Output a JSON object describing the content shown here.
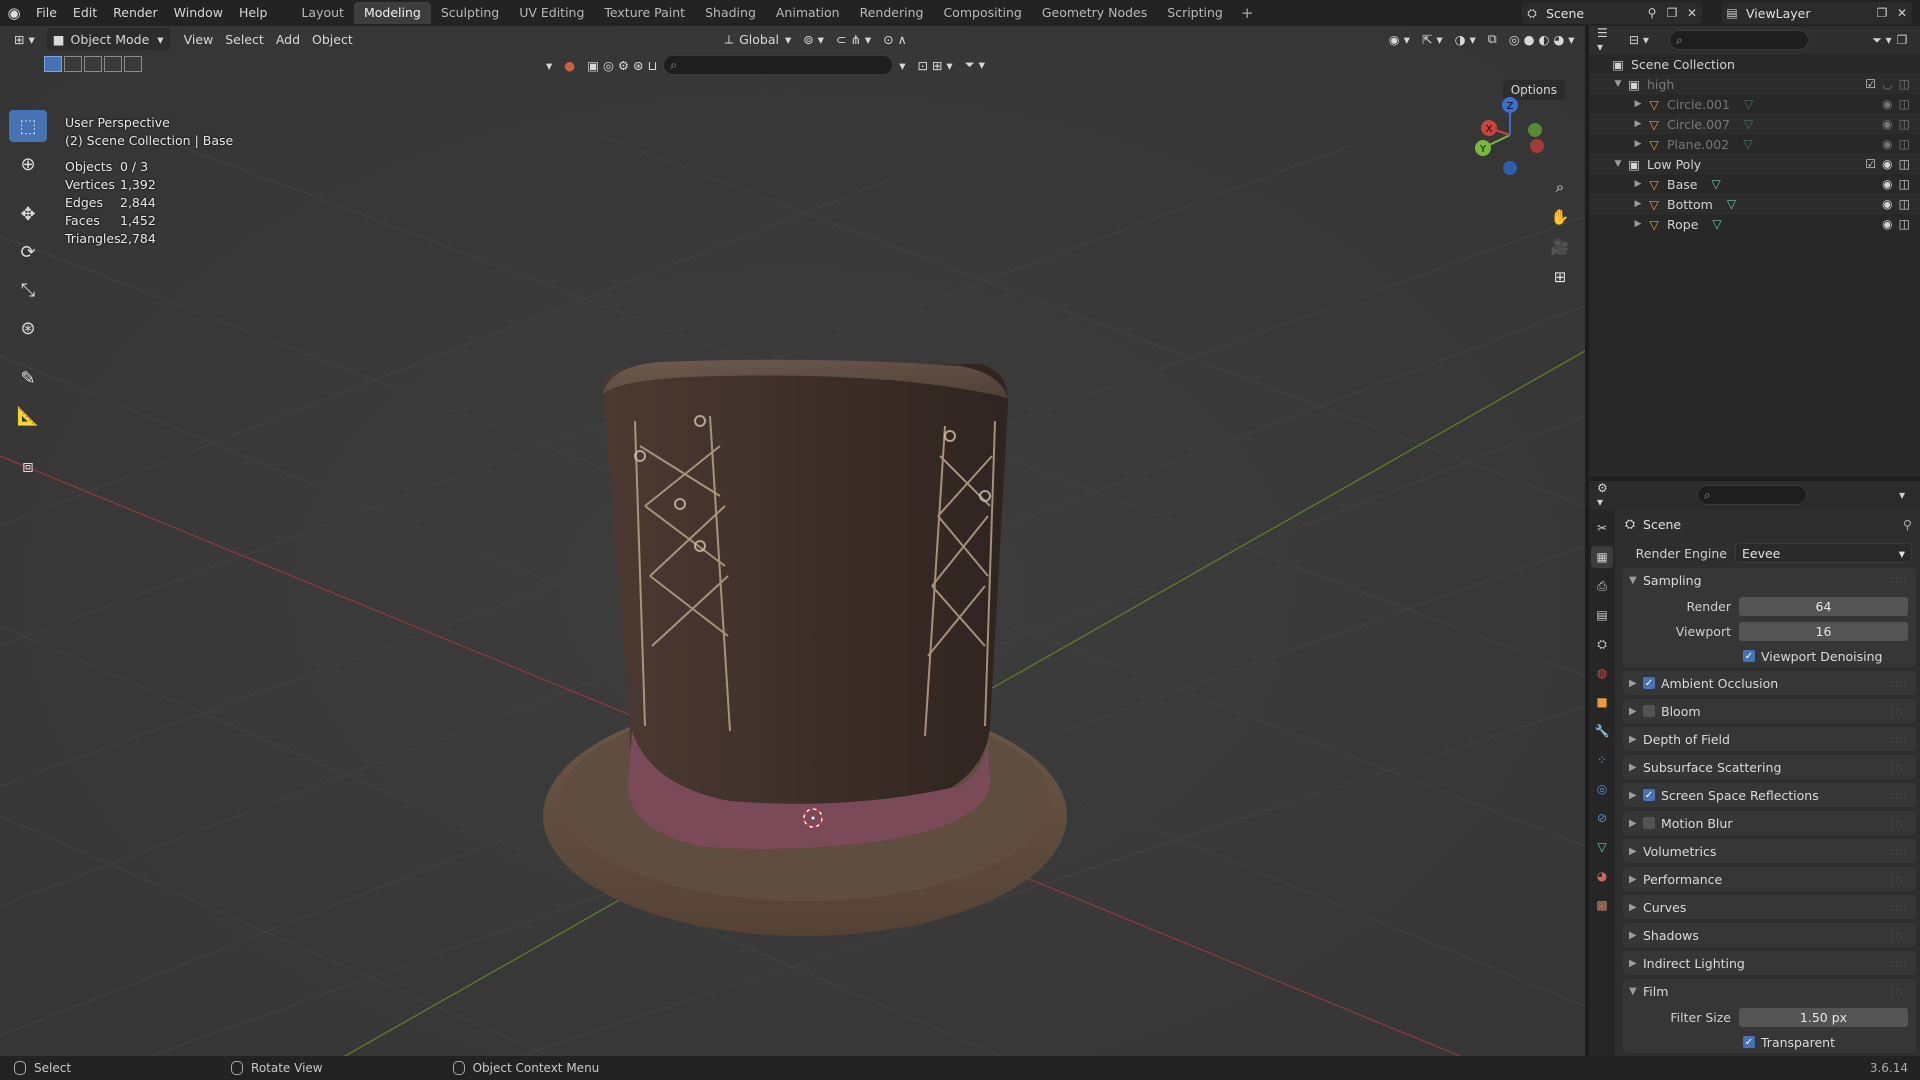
{
  "topbar": {
    "menus": [
      "File",
      "Edit",
      "Render",
      "Window",
      "Help"
    ],
    "workspaces": [
      "Layout",
      "Modeling",
      "Sculpting",
      "UV Editing",
      "Texture Paint",
      "Shading",
      "Animation",
      "Rendering",
      "Compositing",
      "Geometry Nodes",
      "Scripting"
    ],
    "active_workspace": "Modeling",
    "scene_name": "Scene",
    "view_layer": "ViewLayer"
  },
  "viewport": {
    "mode": "Object Mode",
    "menus": [
      "View",
      "Select",
      "Add",
      "Object"
    ],
    "transform_orientation": "Global",
    "options_label": "Options",
    "perspective_label": "User Perspective",
    "collection_label": "(2) Scene Collection | Base",
    "stats": [
      {
        "label": "Objects",
        "value": "0 / 3"
      },
      {
        "label": "Vertices",
        "value": "1,392"
      },
      {
        "label": "Edges",
        "value": "2,844"
      },
      {
        "label": "Faces",
        "value": "1,452"
      },
      {
        "label": "Triangles",
        "value": "2,784"
      }
    ],
    "gizmo_axes": {
      "x": "X",
      "y": "Y",
      "z": "Z"
    }
  },
  "outliner": {
    "root": "Scene Collection",
    "collections": [
      {
        "name": "high",
        "objects": [
          "Circle.001",
          "Circle.007",
          "Plane.002"
        ]
      },
      {
        "name": "Low Poly",
        "objects": [
          "Base",
          "Bottom",
          "Rope"
        ]
      }
    ]
  },
  "properties": {
    "context": "Scene",
    "render_engine_label": "Render Engine",
    "render_engine": "Eevee",
    "sampling": {
      "title": "Sampling",
      "render_label": "Render",
      "render": "64",
      "viewport_label": "Viewport",
      "viewport": "16",
      "denoise_label": "Viewport Denoising"
    },
    "panels": [
      {
        "name": "Ambient Occlusion",
        "checkbox": true,
        "checked": true
      },
      {
        "name": "Bloom",
        "checkbox": true,
        "checked": false
      },
      {
        "name": "Depth of Field",
        "checkbox": false
      },
      {
        "name": "Subsurface Scattering",
        "checkbox": false
      },
      {
        "name": "Screen Space Reflections",
        "checkbox": true,
        "checked": true
      },
      {
        "name": "Motion Blur",
        "checkbox": true,
        "checked": false
      },
      {
        "name": "Volumetrics",
        "checkbox": false
      },
      {
        "name": "Performance",
        "checkbox": false
      },
      {
        "name": "Curves",
        "checkbox": false
      },
      {
        "name": "Shadows",
        "checkbox": false
      },
      {
        "name": "Indirect Lighting",
        "checkbox": false
      }
    ],
    "film": {
      "title": "Film",
      "filter_label": "Filter Size",
      "filter_size": "1.50 px",
      "transparent_label": "Transparent"
    }
  },
  "statusbar": {
    "select": "Select",
    "rotate": "Rotate View",
    "context_menu": "Object Context Menu",
    "version": "3.6.14"
  }
}
